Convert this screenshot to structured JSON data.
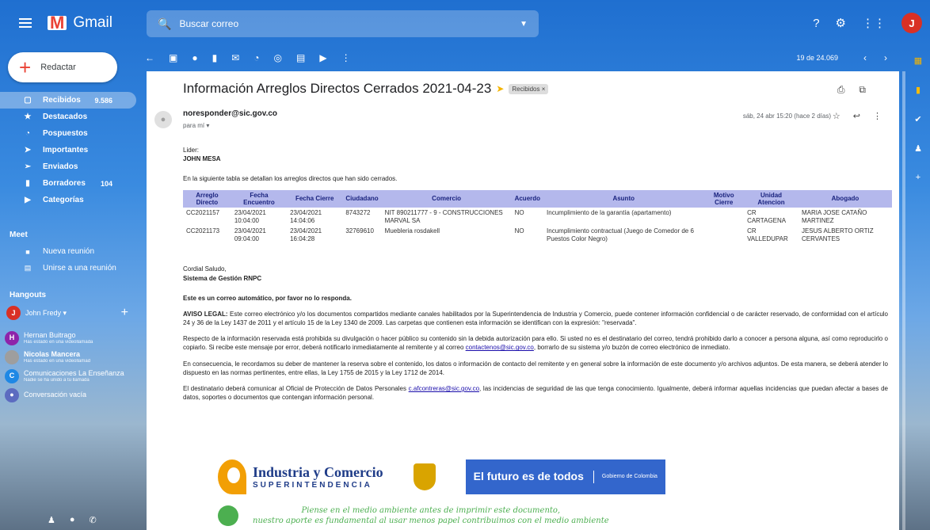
{
  "app": {
    "name": "Gmail",
    "avatar_letter": "J"
  },
  "search": {
    "placeholder": "Buscar correo"
  },
  "compose": {
    "label": "Redactar"
  },
  "nav": [
    {
      "label": "Recibidos",
      "count": "9.586",
      "icon": "inbox-icon",
      "glyph": "▢"
    },
    {
      "label": "Destacados",
      "count": "",
      "icon": "star-icon",
      "glyph": "★"
    },
    {
      "label": "Pospuestos",
      "count": "",
      "icon": "clock-icon",
      "glyph": "◔"
    },
    {
      "label": "Importantes",
      "count": "",
      "icon": "important-icon",
      "glyph": "➤"
    },
    {
      "label": "Enviados",
      "count": "",
      "icon": "send-icon",
      "glyph": "➢"
    },
    {
      "label": "Borradores",
      "count": "104",
      "icon": "draft-icon",
      "glyph": "▮"
    },
    {
      "label": "Categorías",
      "count": "",
      "icon": "label-icon",
      "glyph": "▶"
    }
  ],
  "meet": {
    "title": "Meet",
    "items": [
      {
        "label": "Nueva reunión",
        "icon": "video-icon",
        "glyph": "■"
      },
      {
        "label": "Unirse a una reunión",
        "icon": "keyboard-icon",
        "glyph": "▤"
      }
    ]
  },
  "hangouts": {
    "title": "Hangouts",
    "me": {
      "name": "John Fredy",
      "letter": "J"
    },
    "contacts": [
      {
        "name": "Hernan Buitrago",
        "status": "Has estado en una videollamada",
        "letter": "H",
        "color": "#8e24aa"
      },
      {
        "name": "Nicolas Mancera",
        "status": "Has estado en una videollamad",
        "letter": "",
        "color": "#9e9e9e"
      },
      {
        "name": "Comunicaciones La Enseñanza",
        "status": "Nadie se ha unido a tu llamada",
        "letter": "C",
        "color": "#1e88e5"
      },
      {
        "name": "Conversación vacía",
        "status": "",
        "letter": "",
        "color": "#5c6bc0"
      }
    ]
  },
  "toolbar": {
    "count": "19 de 24.069"
  },
  "email": {
    "subject": "Información Arreglos Directos Cerrados 2021-04-23",
    "label": "Recibidos ×",
    "sender": "noresponder@sic.gov.co",
    "to": "para mí ▾",
    "date": "sáb, 24 abr 15:20 (hace 2 días)",
    "greeting_label": "Lider:",
    "greeting_name": "JOHN MESA",
    "intro": "En la siguiente tabla se detallan los arreglos directos que han sido cerrados.",
    "table": {
      "headers": [
        "Arreglo Directo",
        "Fecha Encuentro",
        "Fecha Cierre",
        "Ciudadano",
        "Comercio",
        "Acuerdo",
        "Asunto",
        "Motivo Cierre",
        "Unidad Atencion",
        "Abogado"
      ],
      "rows": [
        [
          "CC2021157",
          "23/04/2021 10:04:00",
          "23/04/2021 14:04:06",
          "8743272",
          "NIT 890211777 - 9 - CONSTRUCCIONES MARVAL SA",
          "NO",
          "Incumplimiento de la garantía (apartamento)",
          "",
          "CR CARTAGENA",
          "MARIA JOSE CATAÑO MARTINEZ"
        ],
        [
          "CC2021173",
          "23/04/2021 09:04:00",
          "23/04/2021 16:04:28",
          "32769610",
          "Muebleria rosdakell",
          "NO",
          "Incumplimiento contractual (Juego de Comedor de 6 Puestos Color Negro)",
          "",
          "CR VALLEDUPAR",
          "JESUS ALBERTO ORTIZ CERVANTES"
        ]
      ]
    },
    "closing1": "Cordial Saludo,",
    "closing2": "Sistema de Gestión RNPC",
    "auto_notice": "Este es un correo automático, por favor no lo responda.",
    "legal_title": "AVISO LEGAL:",
    "legal1": "Este correo electrónico y/o los documentos compartidos mediante canales habilitados por la Superintendencia de Industria y Comercio, puede contener información confidencial o de carácter reservado, de conformidad con el artículo 24 y 36 de la Ley 1437 de 2011 y el artículo 15 de la Ley 1340 de 2009. Las carpetas que contienen esta información se identifican con la expresión: \"reservada\".",
    "legal2a": "Respecto de la información reservada está prohibida su divulgación o hacer público su contenido sin la debida autorización para ello. Si usted no es el destinatario del correo, tendrá prohibido darlo a conocer a persona alguna, así como reproducirlo o copiarlo. Si recibe este mensaje por error, deberá notificarlo inmediatamente al remitente y al correo",
    "legal2_link": "contactenos@sic.gov.co",
    "legal2b": ", borrarlo de su sistema y/o buzón de correo electrónico de inmediato.",
    "legal3": "En consecuencia, le recordamos su deber de mantener la reserva sobre el contenido, los datos o información de contacto del remitente y en general sobre la información de este documento y/o archivos adjuntos. De esta manera, se deberá atender lo dispuesto en las normas pertinentes, entre ellas, la Ley 1755 de 2015 y la Ley 1712 de 2014.",
    "legal4a": "El destinatario deberá comunicar al Oficial de Protección de Datos Personales",
    "legal4_link": "c.afcontreras@sic.gov.co",
    "legal4b": ", las incidencias de seguridad de las que tenga conocimiento. Igualmente, deberá informar aquellas incidencias que puedan afectar a bases de datos, soportes o documentos que contengan información personal.",
    "logo_ic_1": "Industria y Comercio",
    "logo_ic_2": "SUPERINTENDENCIA",
    "logo_gob_1": "El futuro es de todos",
    "logo_gob_2": "Gobierno de Colombia",
    "env_1": "Piense en el medio ambiente antes de imprimir este documento,",
    "env_2": "nuestro aporte es fundamental al usar menos papel contribuimos con el medio ambiente"
  }
}
